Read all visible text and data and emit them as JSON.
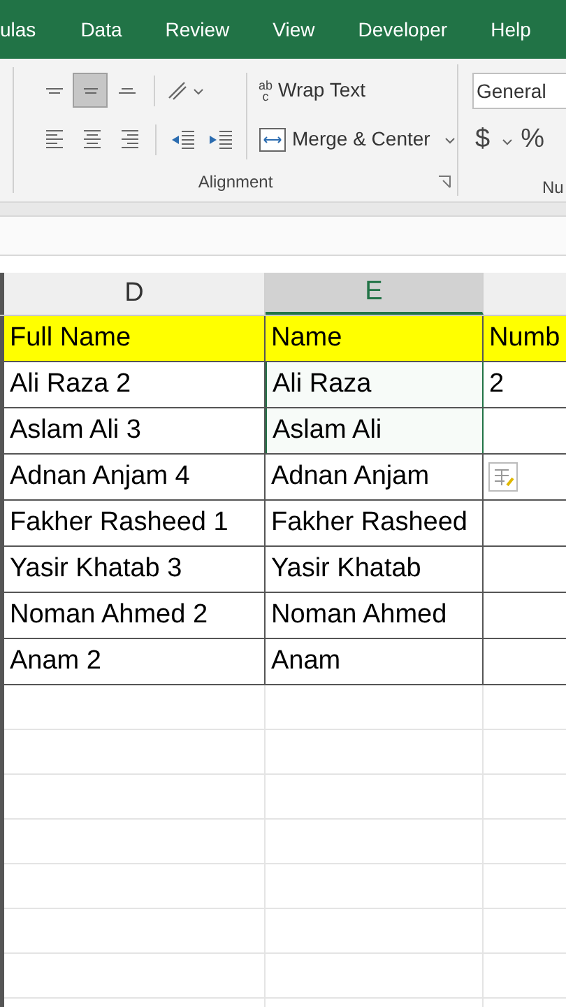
{
  "ribbon_tabs": [
    {
      "label": "ulas"
    },
    {
      "label": "Data"
    },
    {
      "label": "Review"
    },
    {
      "label": "View"
    },
    {
      "label": "Developer"
    },
    {
      "label": "Help"
    }
  ],
  "alignment": {
    "top_row": [
      {
        "kind": "align-top",
        "selected": false
      },
      {
        "kind": "align-middle",
        "selected": true
      },
      {
        "kind": "align-bottom",
        "selected": false
      }
    ],
    "bottom_row": [
      {
        "kind": "align-left",
        "selected": false
      },
      {
        "kind": "align-center",
        "selected": false
      },
      {
        "kind": "align-right",
        "selected": false
      },
      {
        "kind": "indent-decrease",
        "selected": false
      },
      {
        "kind": "indent-increase",
        "selected": false
      }
    ],
    "wrap_text": "Wrap Text",
    "wrap_icon_top": "ab",
    "wrap_icon_bottom": "c",
    "merge_center": "Merge & Center",
    "label": "Alignment"
  },
  "number": {
    "format": "General",
    "currency": "$",
    "percent": "%",
    "label": "Nu"
  },
  "columns": [
    {
      "label": "D",
      "selected": false
    },
    {
      "label": "E",
      "selected": true
    }
  ],
  "header_row": [
    "Full Name",
    "Name",
    "Numb"
  ],
  "rows": [
    {
      "full_name": "Ali Raza 2",
      "name": "Ali Raza",
      "number": "2",
      "selected": true
    },
    {
      "full_name": "Aslam Ali 3",
      "name": "Aslam Ali",
      "selected": true
    },
    {
      "full_name": "Adnan Anjam 4",
      "name": "Adnan Anjam",
      "selected": false
    },
    {
      "full_name": "Fakher Rasheed 1",
      "name": "Fakher Rasheed",
      "selected": false
    },
    {
      "full_name": "Yasir Khatab 3",
      "name": "Yasir Khatab",
      "selected": false
    },
    {
      "full_name": "Noman Ahmed 2",
      "name": "Noman Ahmed",
      "selected": false
    },
    {
      "full_name": "Anam 2",
      "name": "Anam",
      "selected": false
    }
  ]
}
